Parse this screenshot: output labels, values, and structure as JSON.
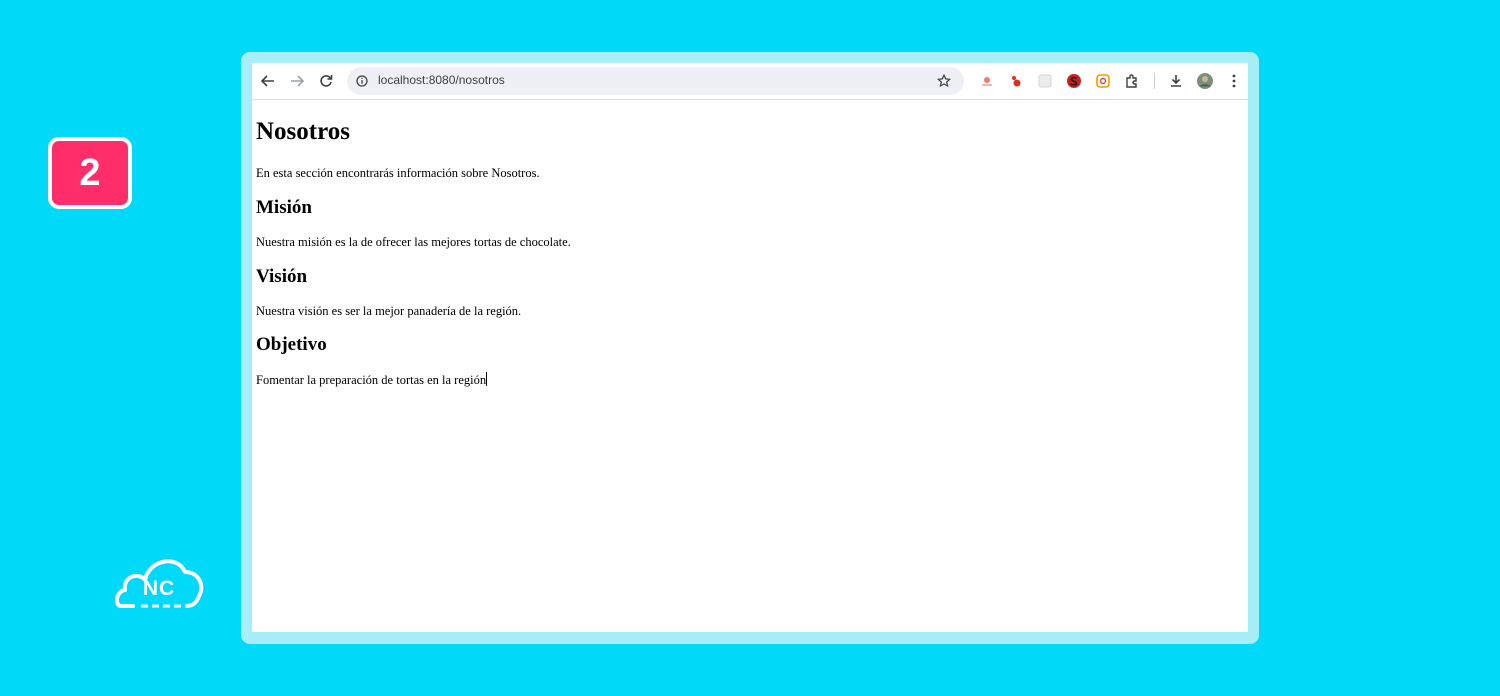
{
  "badge": {
    "step_number": "2"
  },
  "logo": {
    "text": "NC"
  },
  "browser": {
    "url": "localhost:8080/nosotros",
    "extensions": [
      "extension-1-icon",
      "extension-2-icon",
      "extension-3-icon",
      "extension-4-icon",
      "extension-5-icon",
      "puzzle-icon"
    ]
  },
  "page": {
    "title": "Nosotros",
    "intro": "En esta sección encontrarás información sobre Nosotros.",
    "sections": [
      {
        "heading": "Misión",
        "text": "Nuestra misión es la de ofrecer las mejores tortas de chocolate."
      },
      {
        "heading": "Visión",
        "text": "Nuestra visión es ser la mejor panadería de la región."
      },
      {
        "heading": "Objetivo",
        "text": "Fomentar la preparación de tortas en la región"
      }
    ]
  },
  "colors": {
    "background": "#00d9f7",
    "badge": "#ff2d6a",
    "frame": "#a7eef9"
  }
}
